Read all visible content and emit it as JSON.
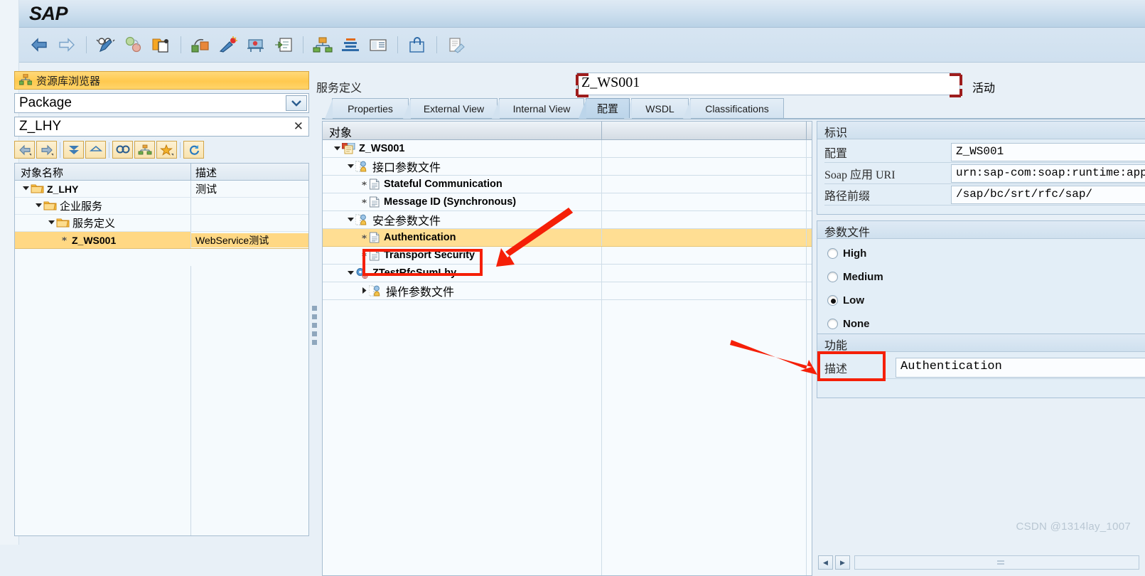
{
  "app": {
    "logo": "SAP"
  },
  "toolbar": {
    "buttons": [
      {
        "name": "back-icon",
        "label": "Back"
      },
      {
        "name": "forward-icon",
        "label": "Forward"
      },
      {
        "name": "display-change-icon",
        "label": "Display <-> Change"
      },
      {
        "name": "activate-icon",
        "label": "Activate"
      },
      {
        "name": "other-object-icon",
        "label": "Other Object"
      },
      {
        "name": "check-icon",
        "label": "Check"
      },
      {
        "name": "test-icon",
        "label": "Test"
      },
      {
        "name": "where-used-icon",
        "label": "Where-Used List"
      },
      {
        "name": "generate-icon",
        "label": "Generate"
      },
      {
        "name": "hierarchy-icon",
        "label": "Object Navigator"
      },
      {
        "name": "stack-icon",
        "label": "Repository Info System"
      },
      {
        "name": "list-icon",
        "label": "Transport Organizer"
      },
      {
        "name": "clipboard-icon",
        "label": "Clipboard"
      },
      {
        "name": "edit-note-icon",
        "label": "Documentation"
      }
    ]
  },
  "sidebar": {
    "title": "资源库浏览器",
    "title_icon": "repository-browser-icon",
    "selector": {
      "value": "Package",
      "icon": "chevron-down-icon"
    },
    "filter": {
      "value": "Z_LHY",
      "clear_icon": "close-icon"
    },
    "tools": [
      {
        "name": "nav-back-icon"
      },
      {
        "name": "nav-forward-icon"
      },
      {
        "name": "expand-all-icon"
      },
      {
        "name": "collapse-all-icon"
      },
      {
        "name": "find-icon"
      },
      {
        "name": "object-list-icon"
      },
      {
        "name": "favorites-icon"
      },
      {
        "name": "refresh-icon"
      }
    ],
    "columns": [
      "对象名称",
      "描述"
    ],
    "rows": [
      {
        "indent": 0,
        "twisty": "down",
        "icon": "folder-icon",
        "name": "Z_LHY",
        "desc": "测试",
        "selected": false,
        "cjk": false
      },
      {
        "indent": 1,
        "twisty": "down",
        "icon": "folder-icon",
        "name": "企业服务",
        "desc": "",
        "selected": false,
        "cjk": true
      },
      {
        "indent": 2,
        "twisty": "down",
        "icon": "folder-icon",
        "name": "服务定义",
        "desc": "",
        "selected": false,
        "cjk": true
      },
      {
        "indent": 3,
        "twisty": "leaf",
        "icon": "none",
        "name": "Z_WS001",
        "desc": "WebService测试",
        "selected": true,
        "cjk": false
      }
    ]
  },
  "main": {
    "service_label": "服务定义",
    "service_name": "Z_WS001",
    "status": "活动",
    "tabs": [
      {
        "label": "Properties",
        "active": false
      },
      {
        "label": "External View",
        "active": false
      },
      {
        "label": "Internal View",
        "active": false
      },
      {
        "label": "配置",
        "active": true
      },
      {
        "label": "WSDL",
        "active": false
      },
      {
        "label": "Classifications",
        "active": false
      }
    ],
    "tree": {
      "column_header": "对象",
      "rows": [
        {
          "indent": 0,
          "twisty": "down",
          "icon": "service-def-icon",
          "label": "Z_WS001",
          "cjk": false,
          "selected": false
        },
        {
          "indent": 1,
          "twisty": "down",
          "icon": "profile-icon",
          "label": "接口参数文件",
          "cjk": true,
          "selected": false
        },
        {
          "indent": 2,
          "twisty": "leaf",
          "icon": "doc-icon",
          "label": "Stateful Communication",
          "cjk": false,
          "selected": false
        },
        {
          "indent": 2,
          "twisty": "leaf",
          "icon": "doc-icon",
          "label": "Message ID (Synchronous)",
          "cjk": false,
          "selected": false
        },
        {
          "indent": 1,
          "twisty": "down",
          "icon": "profile-icon",
          "label": "安全参数文件",
          "cjk": true,
          "selected": false
        },
        {
          "indent": 2,
          "twisty": "leaf",
          "icon": "doc-icon",
          "label": "Authentication",
          "cjk": false,
          "selected": true
        },
        {
          "indent": 2,
          "twisty": "leaf",
          "icon": "doc-icon",
          "label": "Transport Security",
          "cjk": false,
          "selected": false
        },
        {
          "indent": 1,
          "twisty": "down",
          "icon": "operation-icon",
          "label": "ZTestRfcSumLhy",
          "cjk": false,
          "selected": false
        },
        {
          "indent": 2,
          "twisty": "right",
          "icon": "profile-icon",
          "label": "操作参数文件",
          "cjk": true,
          "selected": false
        }
      ]
    }
  },
  "details": {
    "identification": {
      "title": "标识",
      "fields": [
        {
          "label": "配置",
          "value": "Z_WS001"
        },
        {
          "label": "Soap 应用 URI",
          "value": "urn:sap-com:soap:runtime:application:defa"
        },
        {
          "label": "路径前缀",
          "value": "/sap/bc/srt/rfc/sap/"
        }
      ]
    },
    "profile": {
      "title": "参数文件",
      "options": [
        {
          "label": "High",
          "selected": false
        },
        {
          "label": "Medium",
          "selected": false
        },
        {
          "label": "Low",
          "selected": true
        },
        {
          "label": "None",
          "selected": false,
          "highlighted": true
        }
      ]
    },
    "feature": {
      "title": "功能",
      "fields": [
        {
          "label": "描述",
          "value": "Authentication"
        }
      ]
    },
    "scrollbar": {
      "left_icon": "triangle-left-icon",
      "right_icon": "triangle-right-icon"
    }
  },
  "annotations": {
    "highlight_color": "#f51f07",
    "box_color": "#f51f07",
    "service_name_marker_color": "#9e1d1d"
  },
  "watermark": "CSDN @1314lay_1007"
}
